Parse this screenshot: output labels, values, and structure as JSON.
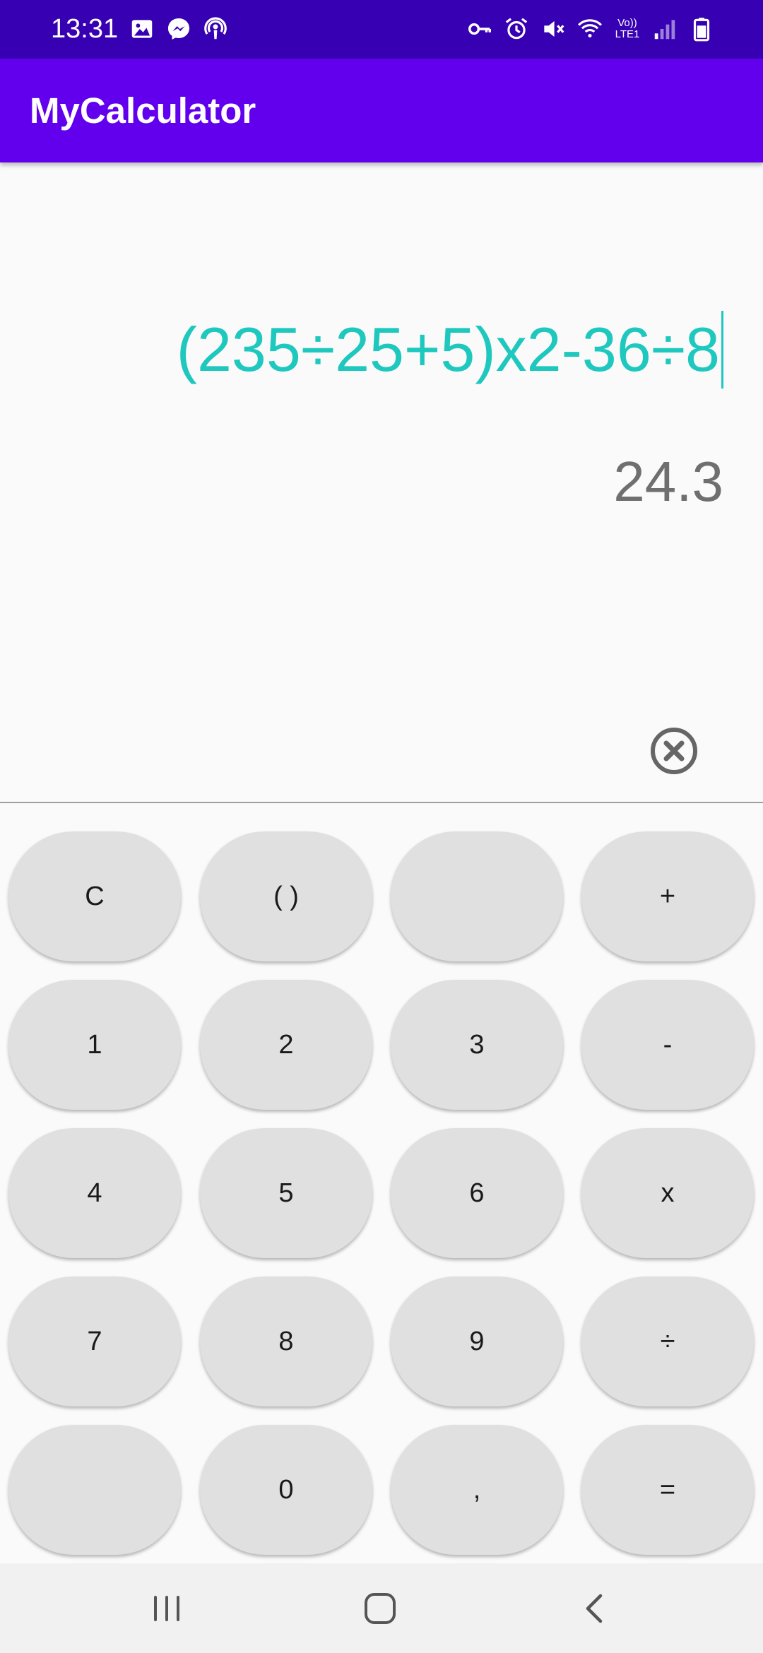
{
  "status_bar": {
    "time": "13:31",
    "left_icons": [
      "image-icon",
      "messenger-icon",
      "podcast-icon"
    ],
    "right_icons": [
      "key-icon",
      "alarm-icon",
      "mute-icon",
      "wifi-icon",
      "volte-icon",
      "signal-icon",
      "battery-icon"
    ],
    "volte_label": "Vo))",
    "lte_label": "LTE1"
  },
  "app_bar": {
    "title": "MyCalculator",
    "color": "#6200ee"
  },
  "display": {
    "expression": "(235÷25+5)x2-36÷8",
    "result": "24.3",
    "expression_color": "#1ec8be",
    "result_color": "#6f6f6f"
  },
  "keypad": {
    "keys": [
      {
        "label": "C"
      },
      {
        "label": "( )"
      },
      {
        "label": ""
      },
      {
        "label": "+"
      },
      {
        "label": "1"
      },
      {
        "label": "2"
      },
      {
        "label": "3"
      },
      {
        "label": "-"
      },
      {
        "label": "4"
      },
      {
        "label": "5"
      },
      {
        "label": "6"
      },
      {
        "label": "x"
      },
      {
        "label": "7"
      },
      {
        "label": "8"
      },
      {
        "label": "9"
      },
      {
        "label": "÷"
      },
      {
        "label": ""
      },
      {
        "label": "0"
      },
      {
        "label": ","
      },
      {
        "label": "="
      }
    ]
  },
  "nav_bar": {
    "buttons": [
      "recent-apps-icon",
      "home-icon",
      "back-icon"
    ]
  }
}
